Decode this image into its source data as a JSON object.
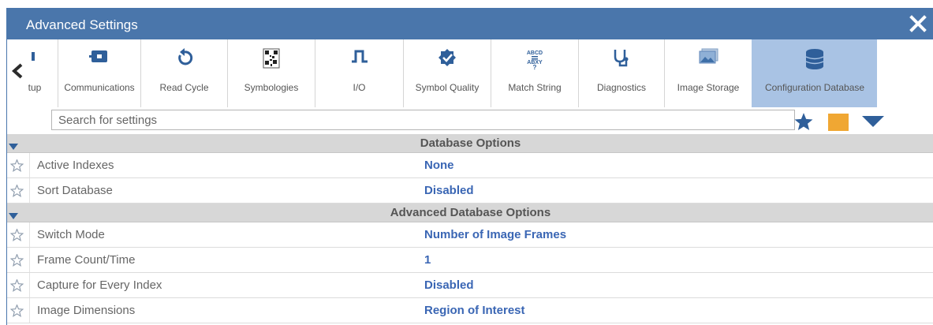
{
  "dialog": {
    "title": "Advanced Settings",
    "close_icon": "close-icon"
  },
  "toolbar": {
    "tabs": [
      {
        "label": "Setup",
        "icon": "setup-icon",
        "display": "etup"
      },
      {
        "label": "Communications",
        "icon": "communications-icon"
      },
      {
        "label": "Read Cycle",
        "icon": "read-cycle-icon"
      },
      {
        "label": "Symbologies",
        "icon": "symbologies-icon"
      },
      {
        "label": "I/O",
        "icon": "io-pulse-icon"
      },
      {
        "label": "Symbol Quality",
        "icon": "symbol-quality-icon"
      },
      {
        "label": "Match String",
        "icon": "match-string-icon"
      },
      {
        "label": "Diagnostics",
        "icon": "stethoscope-icon"
      },
      {
        "label": "Image Storage",
        "icon": "image-storage-icon"
      },
      {
        "label": "Configuration Database",
        "icon": "database-icon",
        "active": true
      }
    ],
    "match_icon_text": [
      "ABCD",
      "ABXY",
      "?"
    ]
  },
  "search": {
    "placeholder": "Search for settings",
    "value": ""
  },
  "colors": {
    "titlebar": "#4a76ab",
    "active_tab": "#a9c3e4",
    "value_text": "#3a66b4",
    "orange": "#f0a733",
    "icon_blue": "#2f5f9a"
  },
  "sections": [
    {
      "title": "Database Options",
      "rows": [
        {
          "name": "Active Indexes",
          "value": "None"
        },
        {
          "name": "Sort Database",
          "value": "Disabled"
        }
      ]
    },
    {
      "title": "Advanced Database Options",
      "rows": [
        {
          "name": "Switch Mode",
          "value": "Number of Image Frames"
        },
        {
          "name": "Frame Count/Time",
          "value": "1"
        },
        {
          "name": "Capture for Every Index",
          "value": "Disabled"
        },
        {
          "name": "Image Dimensions",
          "value": "Region of Interest"
        }
      ]
    }
  ]
}
